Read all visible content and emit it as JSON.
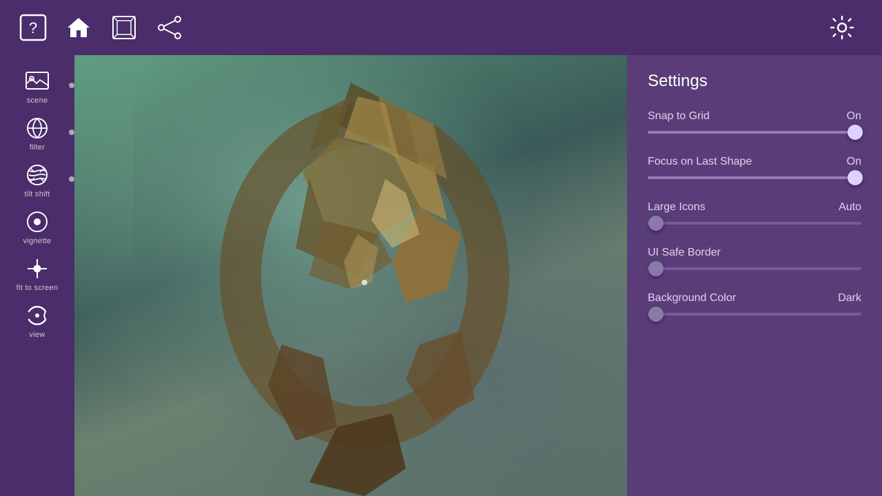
{
  "topNav": {
    "icons": [
      {
        "name": "help-icon",
        "label": "Help"
      },
      {
        "name": "home-icon",
        "label": "Home"
      },
      {
        "name": "cube-icon",
        "label": "3D"
      },
      {
        "name": "share-icon",
        "label": "Share"
      }
    ],
    "rightIcon": {
      "name": "settings-icon",
      "label": "Settings"
    }
  },
  "sidebar": {
    "items": [
      {
        "id": "scene",
        "label": "scene"
      },
      {
        "id": "filter",
        "label": "filter"
      },
      {
        "id": "tilt-shift",
        "label": "tilt shift"
      },
      {
        "id": "vignette",
        "label": "vignette"
      },
      {
        "id": "fit-to-screen",
        "label": "fit to screen"
      },
      {
        "id": "view",
        "label": "view"
      }
    ],
    "dotsAt": [
      0,
      1,
      2
    ]
  },
  "settings": {
    "title": "Settings",
    "items": [
      {
        "id": "snap-to-grid",
        "name": "Snap to Grid",
        "value": "On",
        "thumbPercent": 97,
        "filled": true
      },
      {
        "id": "focus-on-last-shape",
        "name": "Focus on Last Shape",
        "value": "On",
        "thumbPercent": 97,
        "filled": true
      },
      {
        "id": "large-icons",
        "name": "Large Icons",
        "value": "Auto",
        "thumbPercent": 4,
        "filled": false
      },
      {
        "id": "ui-safe-border",
        "name": "UI Safe Border",
        "value": "",
        "thumbPercent": 4,
        "filled": false
      },
      {
        "id": "background-color",
        "name": "Background Color",
        "value": "Dark",
        "thumbPercent": 4,
        "filled": false
      }
    ]
  }
}
